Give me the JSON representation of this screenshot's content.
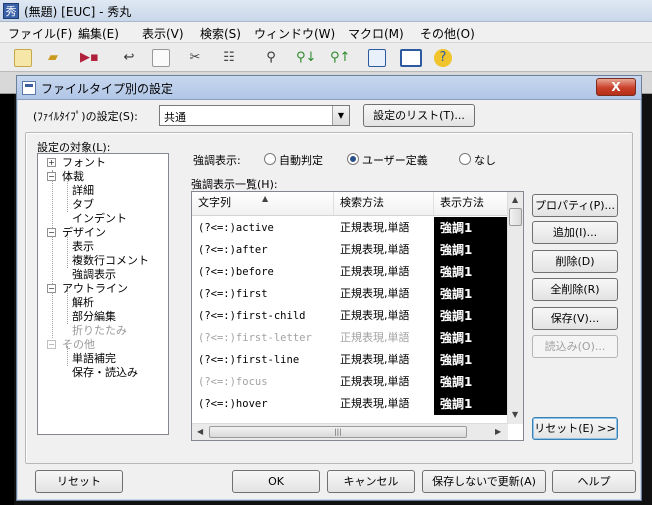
{
  "app": {
    "title": "(無題) [EUC] - 秀丸",
    "menu": [
      "ファイル(F)",
      "編集(E)",
      "表示(V)",
      "検索(S)",
      "ウィンドウ(W)",
      "マクロ(M)",
      "その他(O)"
    ]
  },
  "dialog": {
    "title": "ファイルタイプ別の設定",
    "close_label": "X",
    "type_label": "(ﾌｧｲﾙﾀｲﾌﾟ)の設定(S):",
    "type_value": "共通",
    "settings_list_button": "設定のリスト(T)...",
    "target_label": "設定の対象(L):",
    "tree": [
      {
        "label": "フォント",
        "level": 0,
        "toggle": "+",
        "dim": false
      },
      {
        "label": "体裁",
        "level": 0,
        "toggle": "-",
        "dim": false
      },
      {
        "label": "詳細",
        "level": 1,
        "dim": false
      },
      {
        "label": "タブ",
        "level": 1,
        "dim": false
      },
      {
        "label": "インデント",
        "level": 1,
        "dim": false
      },
      {
        "label": "デザイン",
        "level": 0,
        "toggle": "-",
        "dim": false
      },
      {
        "label": "表示",
        "level": 1,
        "dim": false
      },
      {
        "label": "複数行コメント",
        "level": 1,
        "dim": false
      },
      {
        "label": "強調表示",
        "level": 1,
        "dim": false
      },
      {
        "label": "アウトライン",
        "level": 0,
        "toggle": "-",
        "dim": false
      },
      {
        "label": "解析",
        "level": 1,
        "dim": false
      },
      {
        "label": "部分編集",
        "level": 1,
        "dim": false
      },
      {
        "label": "折りたたみ",
        "level": 1,
        "dim": true
      },
      {
        "label": "その他",
        "level": 0,
        "toggle": "-",
        "dim": true
      },
      {
        "label": "単語補完",
        "level": 1,
        "dim": false
      },
      {
        "label": "保存・読込み",
        "level": 1,
        "dim": false
      }
    ],
    "highlight_label": "強調表示:",
    "radios": [
      "自動判定",
      "ユーザー定義",
      "なし"
    ],
    "radio_selected": 1,
    "list_label": "強調表示一覧(H):",
    "columns": [
      "文字列",
      "検索方法",
      "表示方法"
    ],
    "rows": [
      {
        "pattern": "(?<=:)active",
        "method": "正規表現,単語",
        "display": "強調1",
        "dim": false
      },
      {
        "pattern": "(?<=:)after",
        "method": "正規表現,単語",
        "display": "強調1",
        "dim": false
      },
      {
        "pattern": "(?<=:)before",
        "method": "正規表現,単語",
        "display": "強調1",
        "dim": false
      },
      {
        "pattern": "(?<=:)first",
        "method": "正規表現,単語",
        "display": "強調1",
        "dim": false
      },
      {
        "pattern": "(?<=:)first-child",
        "method": "正規表現,単語",
        "display": "強調1",
        "dim": false
      },
      {
        "pattern": "(?<=:)first-letter",
        "method": "正規表現,単語",
        "display": "強調1",
        "dim": true
      },
      {
        "pattern": "(?<=:)first-line",
        "method": "正規表現,単語",
        "display": "強調1",
        "dim": false
      },
      {
        "pattern": "(?<=:)focus",
        "method": "正規表現,単語",
        "display": "強調1",
        "dim": true
      },
      {
        "pattern": "(?<=:)hover",
        "method": "正規表現,単語",
        "display": "強調1",
        "dim": false
      }
    ],
    "side_buttons": [
      {
        "label": "プロパティ(P)...",
        "disabled": false
      },
      {
        "label": "追加(I)...",
        "disabled": false
      },
      {
        "label": "削除(D)",
        "disabled": false
      },
      {
        "label": "全削除(R)",
        "disabled": false
      },
      {
        "label": "保存(V)...",
        "disabled": false
      },
      {
        "label": "読込み(O)...",
        "disabled": true
      }
    ],
    "reset_e_button": "リセット(E) >>",
    "footer": {
      "reset": "リセット",
      "ok": "OK",
      "cancel": "キャンセル",
      "update_no_save": "保存しないで更新(A)",
      "help": "ヘルプ"
    }
  }
}
